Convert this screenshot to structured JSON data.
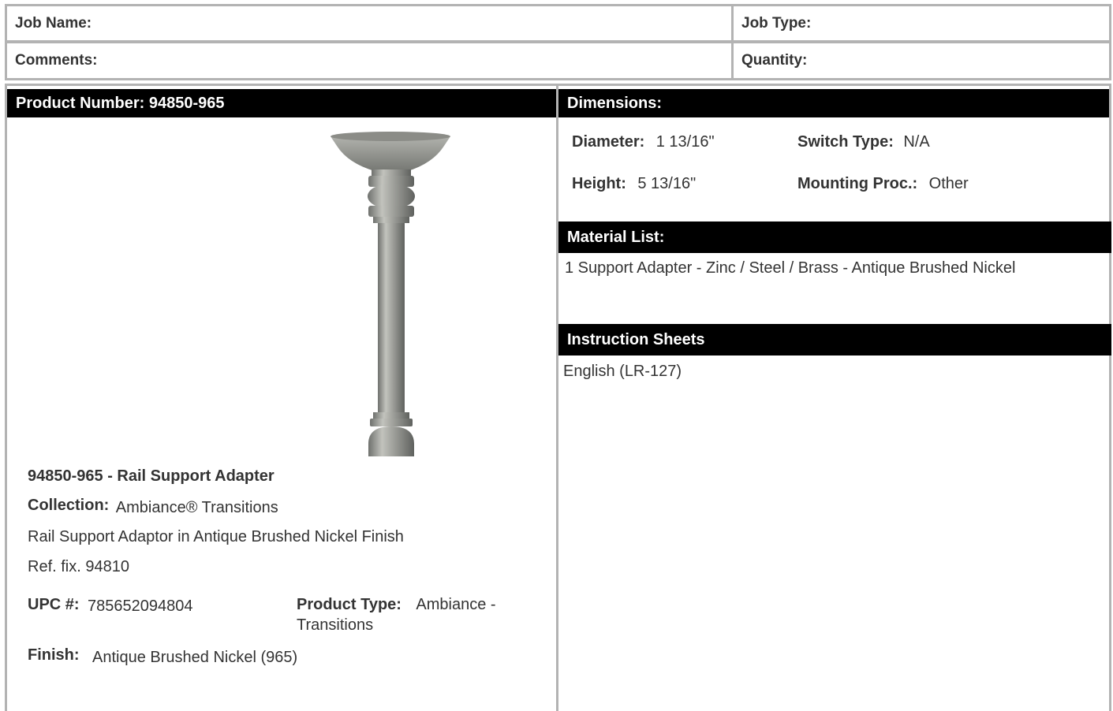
{
  "header": {
    "job_name_label": "Job Name:",
    "job_type_label": "Job Type:",
    "comments_label": "Comments:",
    "quantity_label": "Quantity:"
  },
  "product": {
    "number_bar": "Product Number: 94850-965",
    "title": "94850-965 - Rail Support Adapter",
    "collection_label": "Collection:",
    "collection_value": "Ambiance® Transitions",
    "description": "Rail Support Adaptor in Antique Brushed Nickel Finish",
    "ref": "Ref. fix. 94810",
    "upc_label": "UPC #:",
    "upc_value": "785652094804",
    "product_type_label": "Product Type:",
    "product_type_value": "Ambiance - Transitions",
    "finish_label": "Finish:",
    "finish_value": "Antique Brushed Nickel (965)",
    "image_icon": "rail-support-adapter-image"
  },
  "dimensions": {
    "title": "Dimensions:",
    "diameter_label": "Diameter:",
    "diameter_value": "1 13/16\"",
    "switch_type_label": "Switch Type:",
    "switch_type_value": "N/A",
    "height_label": "Height:",
    "height_value": "5 13/16\"",
    "mounting_label": "Mounting Proc.:",
    "mounting_value": "Other"
  },
  "material_list": {
    "title": "Material List:",
    "items": [
      "1 Support Adapter - Zinc / Steel / Brass - Antique Brushed Nickel"
    ]
  },
  "instruction_sheets": {
    "title": "Instruction Sheets",
    "items": [
      "English (LR-127)"
    ]
  },
  "colors": {
    "bar_bg": "#000000",
    "bar_text": "#ffffff",
    "border": "#b3b3b3",
    "text": "#333333"
  }
}
